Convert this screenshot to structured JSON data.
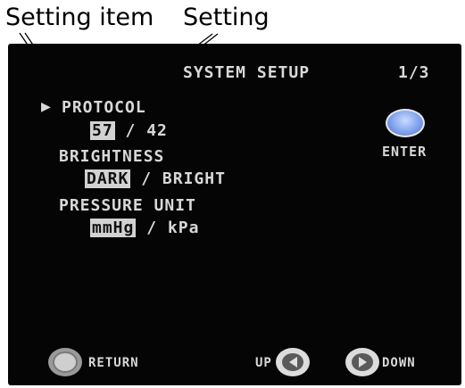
{
  "callouts": {
    "setting_item": "Setting item",
    "setting": "Setting"
  },
  "screen": {
    "title": "SYSTEM SETUP",
    "page": "1/3",
    "cursor": "▶",
    "items": [
      {
        "label": "PROTOCOL",
        "selected": "57",
        "separator": "/",
        "other": "42"
      },
      {
        "label": "BRIGHTNESS",
        "selected": "DARK",
        "separator": "/",
        "other": "BRIGHT"
      },
      {
        "label": "PRESSURE UNIT",
        "selected": "mmHg",
        "separator": "/",
        "other": "kPa"
      }
    ],
    "enter_label": "ENTER",
    "return_label": "RETURN",
    "up_label": "UP",
    "down_label": "DOWN"
  },
  "colors": {
    "screen_bg": "#050505",
    "osd_text": "#d8d8d8",
    "selection_bg": "#d2d2d2",
    "enter_button": "#6d92e6"
  },
  "icons": [
    "enter-button-icon",
    "return-icon",
    "left-arrow-icon",
    "right-arrow-icon",
    "cursor-arrow-icon"
  ]
}
